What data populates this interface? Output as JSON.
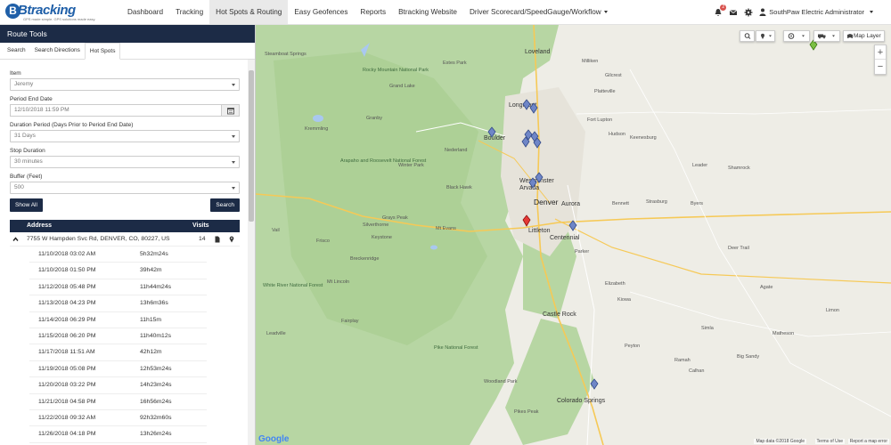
{
  "brand": {
    "name": "Btracking",
    "tagline": "GPS made simple. GPS solutions made easy.",
    "accent": "#1c2b46"
  },
  "nav": {
    "items": [
      {
        "label": "Dashboard"
      },
      {
        "label": "Tracking"
      },
      {
        "label": "Hot Spots & Routing"
      },
      {
        "label": "Easy Geofences"
      },
      {
        "label": "Reports"
      },
      {
        "label": "Btracking Website"
      },
      {
        "label": "Driver Scorecard/SpeedGauge/Workflow"
      }
    ],
    "alerts_count": "2",
    "user": "SouthPaw Electric Administrator"
  },
  "sidebar": {
    "title": "Route Tools",
    "tabs": [
      {
        "label": "Search"
      },
      {
        "label": "Search Directions"
      },
      {
        "label": "Hot Spots"
      }
    ],
    "item_label": "Item",
    "item_value": "Jeremy",
    "period_end_label": "Period End Date",
    "period_end_value": "12/10/2018 11:59 PM",
    "duration_label": "Duration Period (Days Prior to Period End Date)",
    "duration_value": "31 Days",
    "stop_label": "Stop Duration",
    "stop_value": "30 minutes",
    "buffer_label": "Buffer (Feet)",
    "buffer_value": "500",
    "show_all": "Show All",
    "search": "Search"
  },
  "table": {
    "col_address": "Address",
    "col_visits": "Visits",
    "address": "7755 W Hampden Svc Rd, DENVER, CO, 80227, US",
    "visits": "14",
    "details": [
      {
        "date": "11/10/2018 03:02 AM",
        "duration": "5h32m24s"
      },
      {
        "date": "11/10/2018 01:50 PM",
        "duration": "39h42m"
      },
      {
        "date": "11/12/2018 05:48 PM",
        "duration": "11h44m24s"
      },
      {
        "date": "11/13/2018 04:23 PM",
        "duration": "13h6m36s"
      },
      {
        "date": "11/14/2018 06:29 PM",
        "duration": "11h15m"
      },
      {
        "date": "11/15/2018 06:20 PM",
        "duration": "11h40m12s"
      },
      {
        "date": "11/17/2018 11:51 AM",
        "duration": "42h12m"
      },
      {
        "date": "11/19/2018 05:08 PM",
        "duration": "12h53m24s"
      },
      {
        "date": "11/20/2018 03:22 PM",
        "duration": "14h23m24s"
      },
      {
        "date": "11/21/2018 04:58 PM",
        "duration": "16h56m24s"
      },
      {
        "date": "11/22/2018 09:32 AM",
        "duration": "92h32m60s"
      },
      {
        "date": "11/26/2018 04:18 PM",
        "duration": "13h26m24s"
      }
    ]
  },
  "map": {
    "layer_label": "Map Layer",
    "zoom_in": "+",
    "zoom_out": "−",
    "attribution": "Map data ©2018 Google",
    "terms": "Terms of Use",
    "report": "Report a map error",
    "google": "Google",
    "labels": {
      "fort_collins_area": "Loveland",
      "longmont": "Longmont",
      "boulder": "Boulder",
      "westminster": "Westminster",
      "arvada": "Arvada",
      "denver": "Denver",
      "aurora": "Aurora",
      "littleton": "Littleton",
      "centennial": "Centennial",
      "parker": "Parker",
      "castle_rock": "Castle Rock",
      "colorado_springs": "Colorado Springs",
      "estes_park": "Estes Park",
      "silverthorne": "Silverthorne",
      "breckenridge": "Breckenridge",
      "frisco": "Frisco",
      "vail": "Vail",
      "keystone": "Keystone",
      "grays_peak": "Grays Peak",
      "mt_evans": "Mt Evans",
      "kremmling": "Kremmling",
      "granby": "Granby",
      "grand_lake": "Grand Lake",
      "winter_park": "Winter Park",
      "nederland": "Nederland",
      "black_hawk": "Black Hawk",
      "fairplay": "Fairplay",
      "leadville": "Leadville",
      "woodland_park": "Woodland Park",
      "elizabeth": "Elizabeth",
      "kiowa": "Kiowa",
      "deer_trail": "Deer Trail",
      "bennett": "Bennett",
      "strasburg": "Strasburg",
      "byers": "Byers",
      "hudson": "Hudson",
      "keenesburg": "Keenesburg",
      "greeley_area": "Milliken",
      "gilcrest": "Gilcrest",
      "platteville": "Platteville",
      "fort_lupton": "Fort Lupton",
      "simla": "Simla",
      "calhan": "Calhan",
      "limon": "Limon",
      "agate": "Agate",
      "shamrock": "Shamrock",
      "leader": "Leader",
      "peyton": "Peyton",
      "ramah": "Ramah",
      "matheson": "Matheson",
      "big_sandy": "Big Sandy",
      "pikes_peak": "Pikes Peak",
      "arapaho_nf": "Arapaho and Roosevelt National Forest",
      "white_river": "White River National Forest",
      "pike_nf": "Pike National Forest",
      "mt_lincoln": "Mt Lincoln",
      "rocky_mtn": "Rocky Mountain National Park",
      "steamboat": "Steamboat Springs"
    }
  }
}
